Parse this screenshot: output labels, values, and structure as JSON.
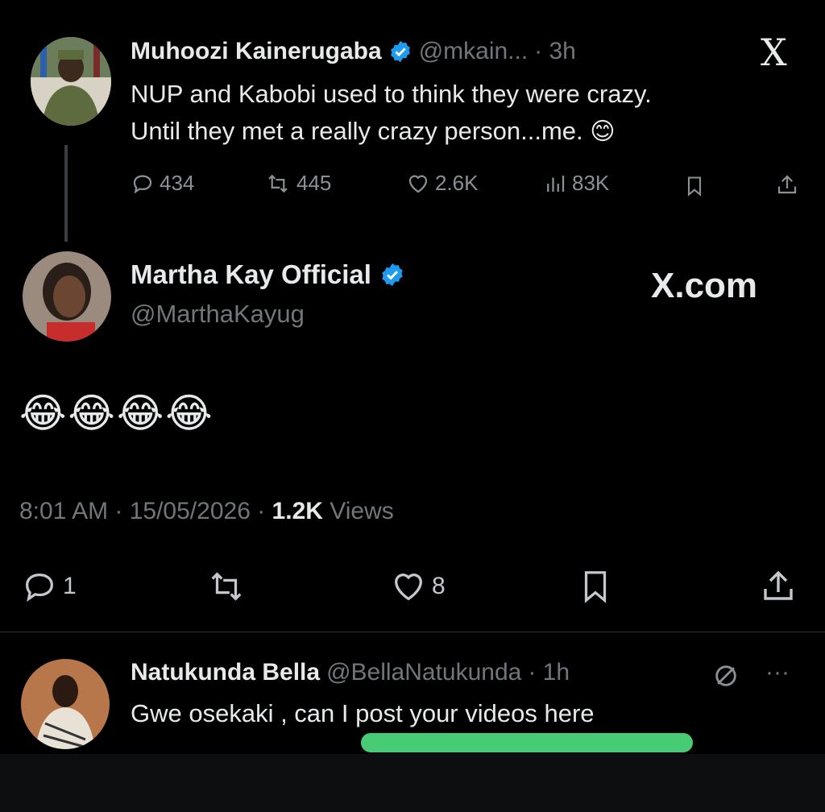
{
  "tweet1": {
    "name": "Muhoozi Kainerugaba",
    "handle": "@mkain...",
    "time": "· 3h",
    "line1": "NUP and Kabobi used to think they were crazy.",
    "line2": "Until they met a really crazy person...me.",
    "emoji": "😊",
    "stats": {
      "replies": "434",
      "reposts": "445",
      "likes": "2.6K",
      "views": "83K"
    },
    "logo": "X"
  },
  "reply": {
    "name": "Martha Kay Official",
    "handle": "@MarthaKayug",
    "watermark": "X.com",
    "emojis": "😂😂😂😂",
    "timestamp": "8:01 AM · 15/05/2026 · ",
    "views_count": "1.2K",
    "views_label": " Views",
    "actions": {
      "replies": "1",
      "likes": "8"
    }
  },
  "tweet3": {
    "name": "Natukunda Bella",
    "handle": "@BellaNatukunda",
    "time": "· 1h",
    "text": "Gwe osekaki , can I post your videos here",
    "more": "···"
  },
  "colors": {
    "verified": "#1d9bf0",
    "highlight": "#4bd67a",
    "muted": "#71767b"
  }
}
